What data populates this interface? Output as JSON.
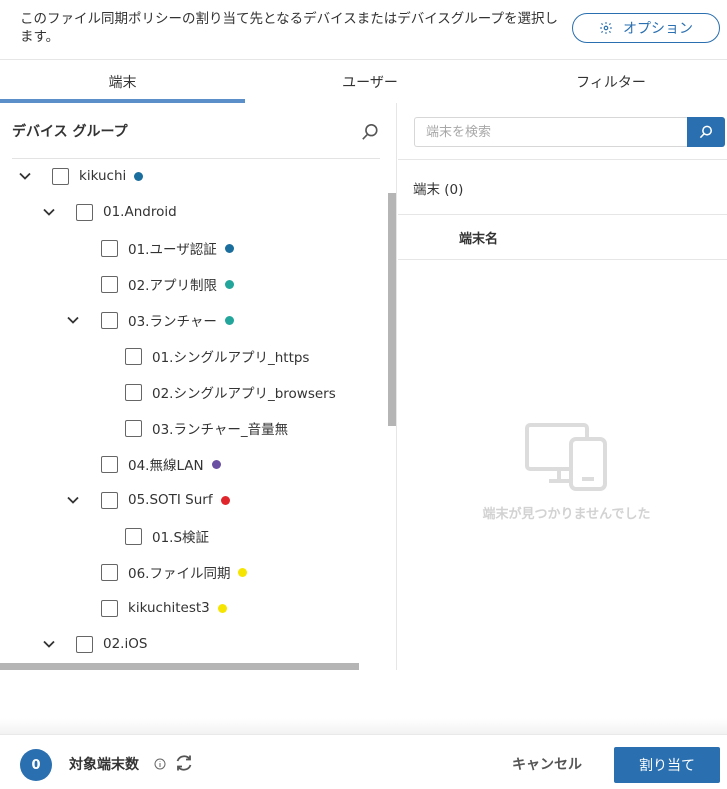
{
  "header": {
    "description": "このファイル同期ポリシーの割り当て先となるデバイスまたはデバイスグループを選択します。",
    "options_label": "オプション"
  },
  "tabs": [
    {
      "label": "端末",
      "active": true
    },
    {
      "label": "ユーザー",
      "active": false
    },
    {
      "label": "フィルター",
      "active": false
    }
  ],
  "device_groups": {
    "heading": "デバイス グループ",
    "tree": [
      {
        "label": "kikuchi",
        "dot": "#1a6e9e",
        "expanded": true
      },
      {
        "label": "01.Android",
        "dot": null,
        "expanded": true
      },
      {
        "label": "01.ユーザ認証",
        "dot": "#1a6e9e",
        "expanded": null
      },
      {
        "label": "02.アプリ制限",
        "dot": "#22a59a",
        "expanded": null
      },
      {
        "label": "03.ランチャー",
        "dot": "#22a59a",
        "expanded": true
      },
      {
        "label": "01.シングルアプリ_https",
        "dot": null,
        "expanded": null
      },
      {
        "label": "02.シングルアプリ_browsers",
        "dot": null,
        "expanded": null
      },
      {
        "label": "03.ランチャー_音量無",
        "dot": null,
        "expanded": null
      },
      {
        "label": "04.無線LAN",
        "dot": "#6b4fa3",
        "expanded": null
      },
      {
        "label": "05.SOTI Surf",
        "dot": "#e0262c",
        "expanded": true
      },
      {
        "label": "01.S検証",
        "dot": null,
        "expanded": null
      },
      {
        "label": "06.ファイル同期",
        "dot": "#f5e500",
        "expanded": null
      },
      {
        "label": "kikuchitest3",
        "dot": "#f5e500",
        "expanded": null
      },
      {
        "label": "02.iOS",
        "dot": null,
        "expanded": true
      }
    ]
  },
  "devices": {
    "search_placeholder": "端末を検索",
    "count_label": "端末 (0)",
    "column_name": "端末名",
    "empty_message": "端末が見つかりませんでした"
  },
  "footer": {
    "target_count": "0",
    "target_label": "対象端末数",
    "cancel_label": "キャンセル",
    "assign_label": "割り当て"
  },
  "colors": {
    "accent": "#2a6fb0",
    "tab_underline": "#5b8fc9"
  }
}
